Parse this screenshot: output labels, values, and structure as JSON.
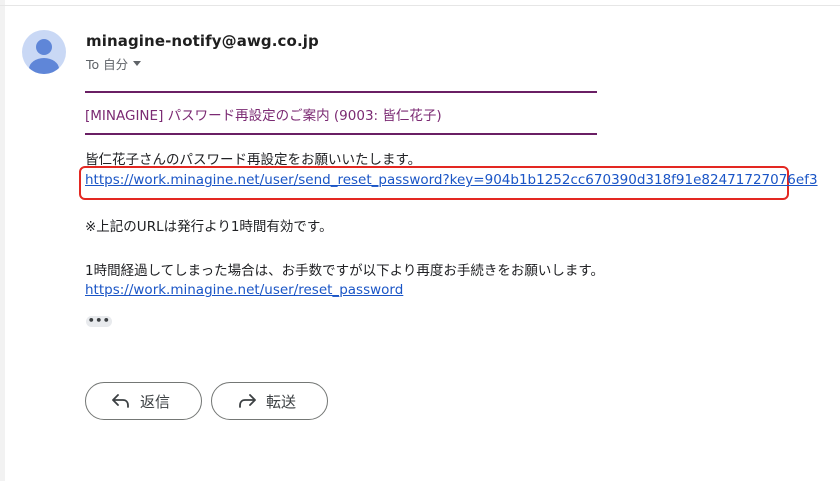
{
  "email": {
    "sender": "minagine-notify@awg.co.jp",
    "to_label": "To 自分",
    "body": {
      "subject_line": "[MINAGINE] パスワード再設定のご案内 (9003: 皆仁花子)",
      "greeting": "皆仁花子さんのパスワード再設定をお願いいたします。",
      "reset_link": "https://work.minagine.net/user/send_reset_password?key=904b1b1252cc670390d318f91e82471727076ef3",
      "validity_note": "※上記のURLは発行より1時間有効です。",
      "expired_note": "1時間経過してしまった場合は、お手数ですが以下より再度お手続きをお願いします。",
      "reissue_link": "https://work.minagine.net/user/reset_password"
    },
    "more_label": "•••"
  },
  "actions": {
    "reply_label": "返信",
    "forward_label": "転送"
  },
  "icons": {
    "avatar": "avatar-icon",
    "caret": "chevron-down-icon",
    "reply": "reply-icon",
    "forward": "forward-icon"
  },
  "colors": {
    "link": "#1a55c6",
    "subject": "#7b2a73",
    "highlight": "#e32822",
    "avatar_bg": "#c9d8f5",
    "avatar_fg": "#5f86d8"
  }
}
